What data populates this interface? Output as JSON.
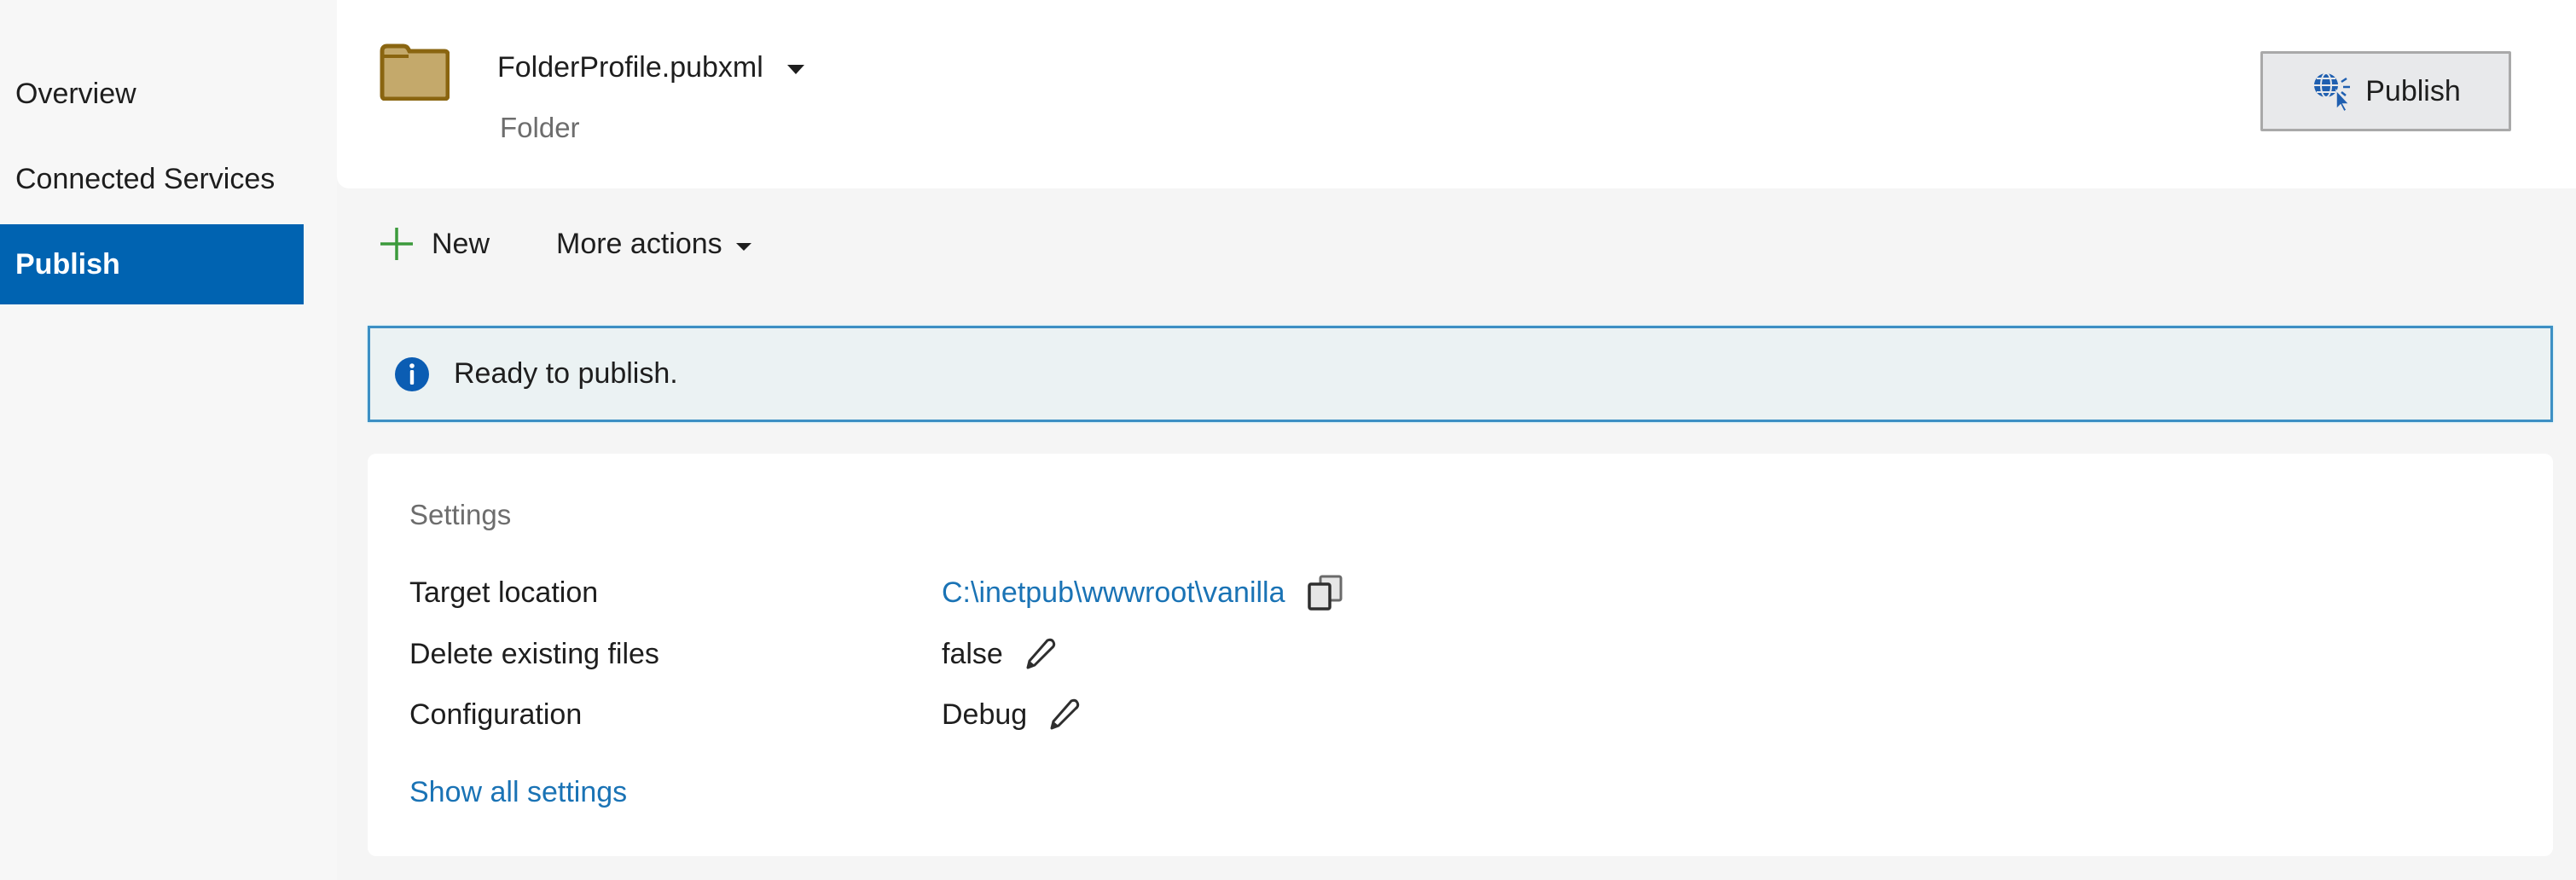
{
  "sidebar": {
    "items": [
      {
        "label": "Overview",
        "active": false
      },
      {
        "label": "Connected Services",
        "active": false
      },
      {
        "label": "Publish",
        "active": true
      }
    ]
  },
  "header": {
    "icon": "folder-icon",
    "profile_name": "FolderProfile.pubxml",
    "profile_type": "Folder",
    "publish_button_label": "Publish",
    "publish_button_icon": "globe-cursor-icon"
  },
  "toolbar": {
    "new_label": "New",
    "more_actions_label": "More actions"
  },
  "status": {
    "icon": "info-icon",
    "message": "Ready to publish."
  },
  "settings": {
    "title": "Settings",
    "rows": [
      {
        "label": "Target location",
        "value": "C:\\inetpub\\wwwroot\\vanilla",
        "action_icon": "copy-icon"
      },
      {
        "label": "Delete existing files",
        "value": "false",
        "action_icon": "edit-pencil-icon"
      },
      {
        "label": "Configuration",
        "value": "Debug",
        "action_icon": "edit-pencil-icon"
      }
    ],
    "show_all_label": "Show all settings"
  },
  "colors": {
    "accent": "#0063b1",
    "link": "#1a73b5",
    "info_border": "#3d8fc4",
    "info_bg": "#ebf2f3",
    "new_plus": "#3c9a3c",
    "folder": "#c4a96b"
  }
}
